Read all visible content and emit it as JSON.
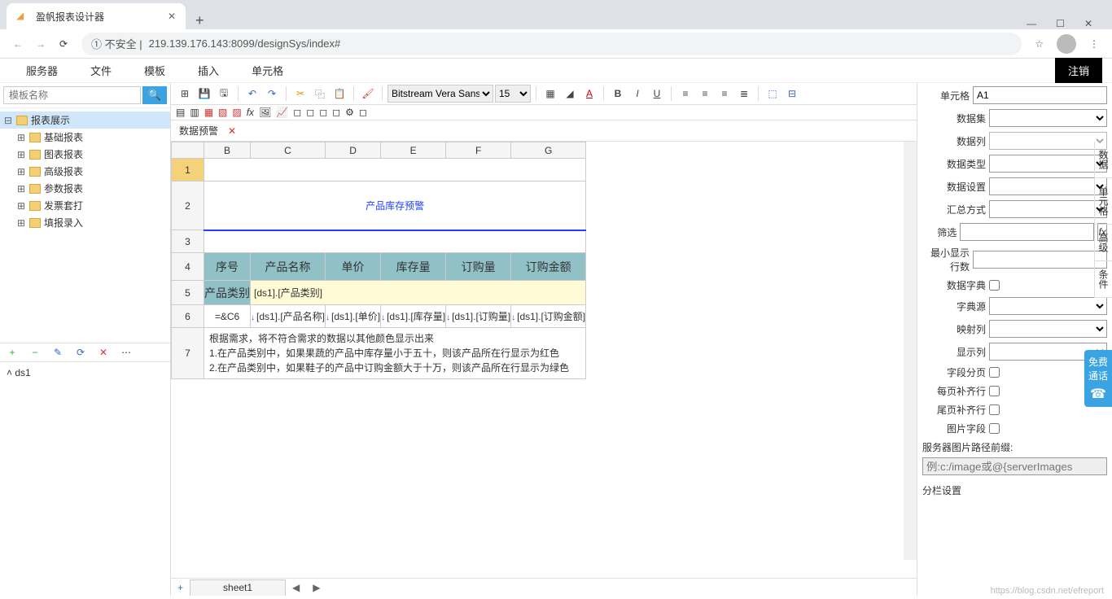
{
  "browser": {
    "tab_title": "盈帆报表设计器",
    "url_prefix": "① 不安全 | ",
    "url": "219.139.176.143:8099/designSys/index#"
  },
  "menu": {
    "server": "服务器",
    "file": "文件",
    "template": "模板",
    "insert": "插入",
    "cell": "单元格",
    "logout": "注销"
  },
  "left": {
    "search_placeholder": "模板名称",
    "root": "报表展示",
    "items": [
      "基础报表",
      "图表报表",
      "高级报表",
      "参数报表",
      "发票套打",
      "填报录入"
    ],
    "ds1": "ds1"
  },
  "toolbar": {
    "font": "Bitstream Vera Sans",
    "size": "15"
  },
  "doc_tab": {
    "name": "数据预警"
  },
  "sheet": {
    "cols": [
      "B",
      "C",
      "D",
      "E",
      "F",
      "G"
    ],
    "rows": [
      "1",
      "2",
      "3",
      "4",
      "5",
      "6",
      "7"
    ],
    "title": "产品库存预警",
    "headers": [
      "序号",
      "产品名称",
      "单价",
      "库存量",
      "订购量",
      "订购金额"
    ],
    "cat_label": "产品类别",
    "cat_value": "[ds1].[产品类别]",
    "data_row": [
      "=&C6",
      "[ds1].[产品名称]",
      "[ds1].[单价]",
      "[ds1].[库存量]",
      "[ds1].[订购量]",
      "[ds1].[订购金额]"
    ],
    "note1": "根据需求，将不符合需求的数据以其他颜色显示出来",
    "note2": "1.在产品类别中，如果果蔬的产品中库存量小于五十，则该产品所在行显示为红色",
    "note3": "2.在产品类别中，如果鞋子的产品中订购金额大于十万，则该产品所在行显示为绿色",
    "tab": "sheet1"
  },
  "props": {
    "cell_label": "单元格",
    "cell_value": "A1",
    "dataset": "数据集",
    "datacol": "数据列",
    "datatype": "数据类型",
    "datasetting": "数据设置",
    "summary": "汇总方式",
    "filter": "筛选",
    "minrows": "最小显示行数",
    "dict": "数据字典",
    "dictsrc": "字典源",
    "mapcol": "映射列",
    "showcol": "显示列",
    "fieldpage": "字段分页",
    "fillrow": "每页补齐行",
    "tailfill": "尾页补齐行",
    "imgfield": "图片字段",
    "imgprefix_label": "服务器图片路径前缀:",
    "imgprefix_placeholder": "例:c:/image或@{serverImages",
    "columnset": "分栏设置"
  },
  "sidetabs": {
    "t1": "数据",
    "t2": "单元格",
    "t3": "高级",
    "t4": "条件"
  },
  "float": {
    "text": "免费通话"
  },
  "watermark": "https://blog.csdn.net/efreport"
}
